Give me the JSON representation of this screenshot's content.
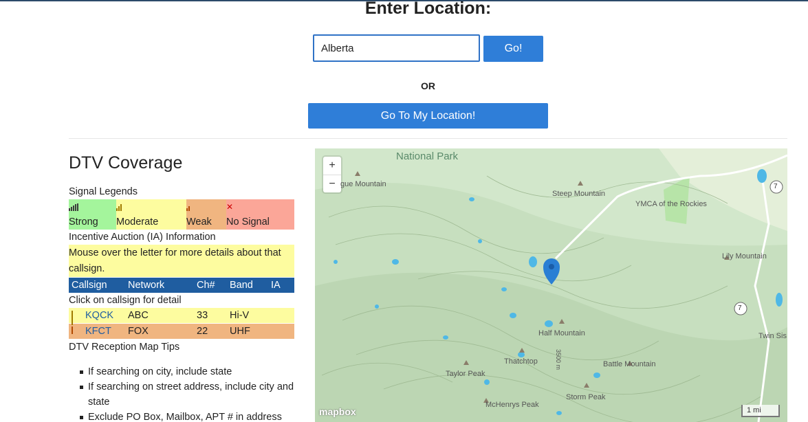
{
  "header": {
    "title": "Enter Location:"
  },
  "search": {
    "value": "Alberta",
    "go_label": "Go!",
    "or_label": "OR",
    "locate_label": "Go To My Location!"
  },
  "coverage": {
    "title": "DTV Coverage",
    "legend_title": "Signal Legends",
    "legend": [
      {
        "label": "Strong",
        "color": "#a4f59c",
        "icon": "signal-strong-icon"
      },
      {
        "label": "Moderate",
        "color": "#fdfc9f",
        "icon": "signal-moderate-icon"
      },
      {
        "label": "Weak",
        "color": "#f0b580",
        "icon": "signal-weak-icon"
      },
      {
        "label": "No Signal",
        "color": "#fba698",
        "icon": "no-signal-icon"
      }
    ],
    "ia_title": "Incentive Auction (IA) Information",
    "ia_note": "Mouse over the letter for more details about that callsign.",
    "columns": [
      "Callsign",
      "Network",
      "Ch#",
      "Band",
      "IA"
    ],
    "click_note": "Click on callsign for detail",
    "stations": [
      {
        "callsign": "KQCK",
        "network": "ABC",
        "channel": "33",
        "band": "Hi-V",
        "ia": "",
        "signal": "moderate"
      },
      {
        "callsign": "KFCT",
        "network": "FOX",
        "channel": "22",
        "band": "UHF",
        "ia": "",
        "signal": "weak"
      }
    ],
    "tips_title": "DTV Reception Map Tips",
    "tips": [
      "If searching on city, include state",
      "If searching on street address, include city and state",
      "Exclude PO Box, Mailbox, APT # in address"
    ]
  },
  "map": {
    "zoom_in": "+",
    "zoom_out": "−",
    "labels": [
      "National Park",
      "gue Mountain",
      "Steep Mountain",
      "YMCA of the Rockies",
      "Lily Mountain",
      "Half Mountain",
      "Thatchtop",
      "Taylor Peak",
      "Battle Mountain",
      "Twin Sis",
      "Storm Peak",
      "McHenrys Peak",
      "3500 m"
    ],
    "route_shields": [
      "7",
      "7"
    ],
    "brand": "mapbox",
    "scale": "1 mi",
    "colors": {
      "terrain": "#cfe6c7",
      "water": "#4fb8e6",
      "road": "#ffffff",
      "marker": "#2a7fd4"
    }
  }
}
